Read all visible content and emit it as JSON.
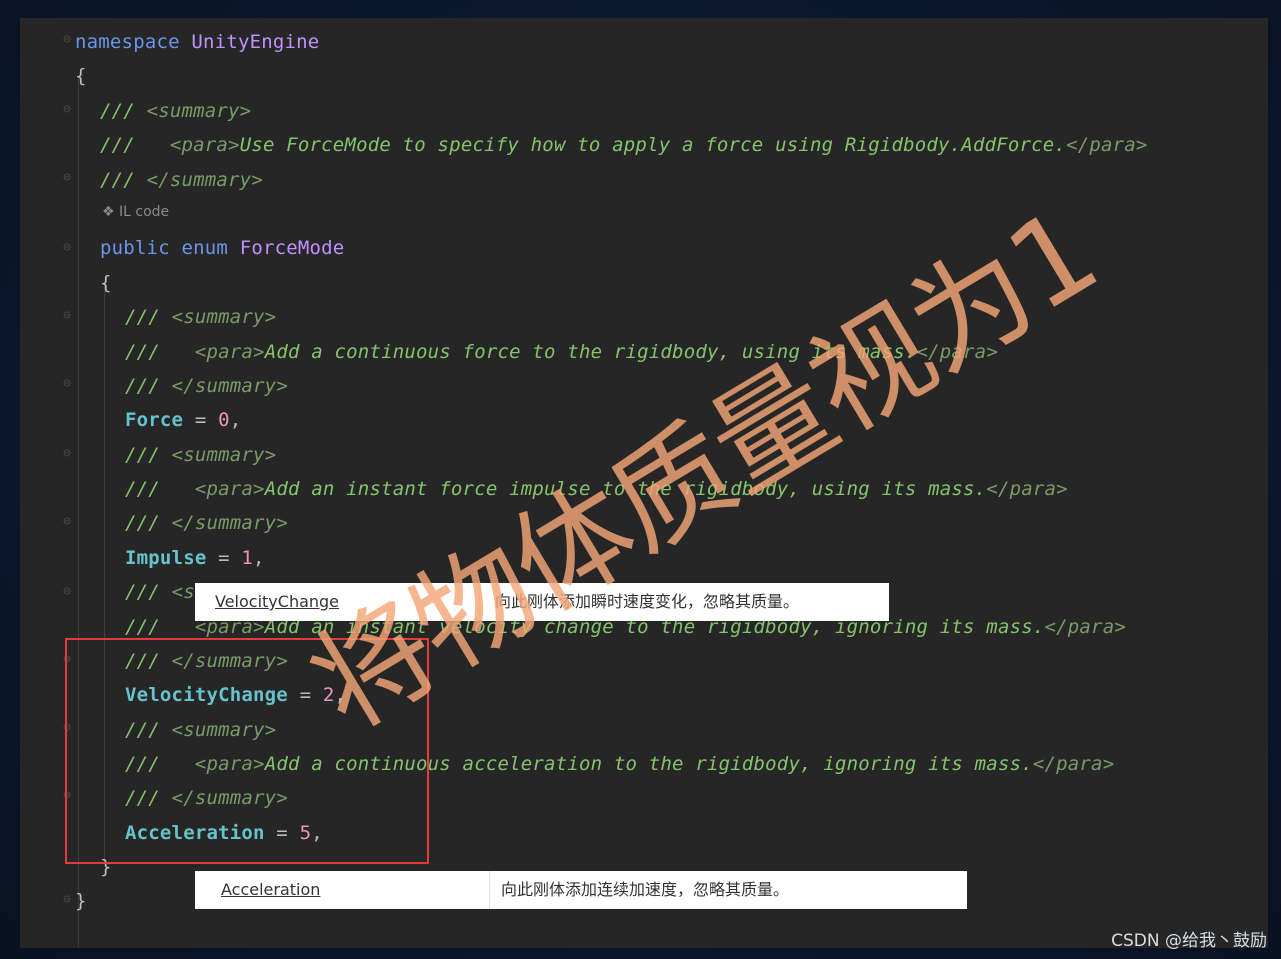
{
  "code": {
    "l1_kw": "namespace",
    "l1_name": "UnityEngine",
    "l2": "{",
    "l3_slashes": "/// ",
    "l3_tag": "<summary>",
    "l4_slashes": "///   ",
    "l4_tag1": "<para>",
    "l4_text": "Use ForceMode to specify how to apply a force using Rigidbody.AddForce.",
    "l4_tag2": "</para>",
    "l5_slashes": "/// ",
    "l5_tag": "</summary>",
    "ilcode": "❖ IL code",
    "l6_kw1": "public",
    "l6_kw2": "enum",
    "l6_name": "ForceMode",
    "l7": "{",
    "l8_slashes": "/// ",
    "l8_tag": "<summary>",
    "l9_slashes": "///   ",
    "l9_tag1": "<para>",
    "l9_text": "Add a continuous force to the rigidbody, using its mass.",
    "l9_tag2": "</para>",
    "l10_slashes": "/// ",
    "l10_tag": "</summary>",
    "l11_name": "Force",
    "l11_op": " = ",
    "l11_val": "0",
    "l11_end": ",",
    "l12_slashes": "/// ",
    "l12_tag": "<summary>",
    "l13_slashes": "///   ",
    "l13_tag1": "<para>",
    "l13_text": "Add an instant force impulse to the rigidbody, using its mass.",
    "l13_tag2": "</para>",
    "l14_slashes": "/// ",
    "l14_tag": "</summary>",
    "l15_name": "Impulse",
    "l15_op": " = ",
    "l15_val": "1",
    "l15_end": ",",
    "l16_slashes": "/// ",
    "l16_tag": "<summary>",
    "l17_slashes": "///   ",
    "l17_tag1": "<para>",
    "l17_text": "Add an instant velocity change to the rigidbody, ignoring its mass.",
    "l17_tag2": "</para>",
    "l18_slashes": "/// ",
    "l18_tag": "</summary>",
    "l19_name": "VelocityChange",
    "l19_op": " = ",
    "l19_val": "2",
    "l19_end": ",",
    "l20_slashes": "/// ",
    "l20_tag": "<summary>",
    "l21_slashes": "///   ",
    "l21_tag1": "<para>",
    "l21_text": "Add a continuous acceleration to the rigidbody, ignoring its mass.",
    "l21_tag2": "</para>",
    "l22_slashes": "/// ",
    "l22_tag": "</summary>",
    "l23_name": "Acceleration",
    "l23_op": " = ",
    "l23_val": "5",
    "l23_end": ",",
    "l24": "}",
    "l25": "}"
  },
  "doc_rows": [
    {
      "name": "VelocityChange",
      "desc": "向此刚体添加瞬时速度变化，忽略其质量。"
    },
    {
      "name": "Acceleration",
      "desc": "向此刚体添加连续加速度，忽略其质量。"
    }
  ],
  "watermark": "将物体质量视为1",
  "credit": "CSDN @给我丶鼓励",
  "colors": {
    "background": "#0a1a2e",
    "editor": "#262626",
    "keyword": "#6c95eb",
    "type_name": "#c191ff",
    "comment": "#85c46c",
    "enum_member": "#66c3cc",
    "number": "#ed94c0",
    "highlight_box": "#e23b3b",
    "watermark": "#f4a678"
  }
}
